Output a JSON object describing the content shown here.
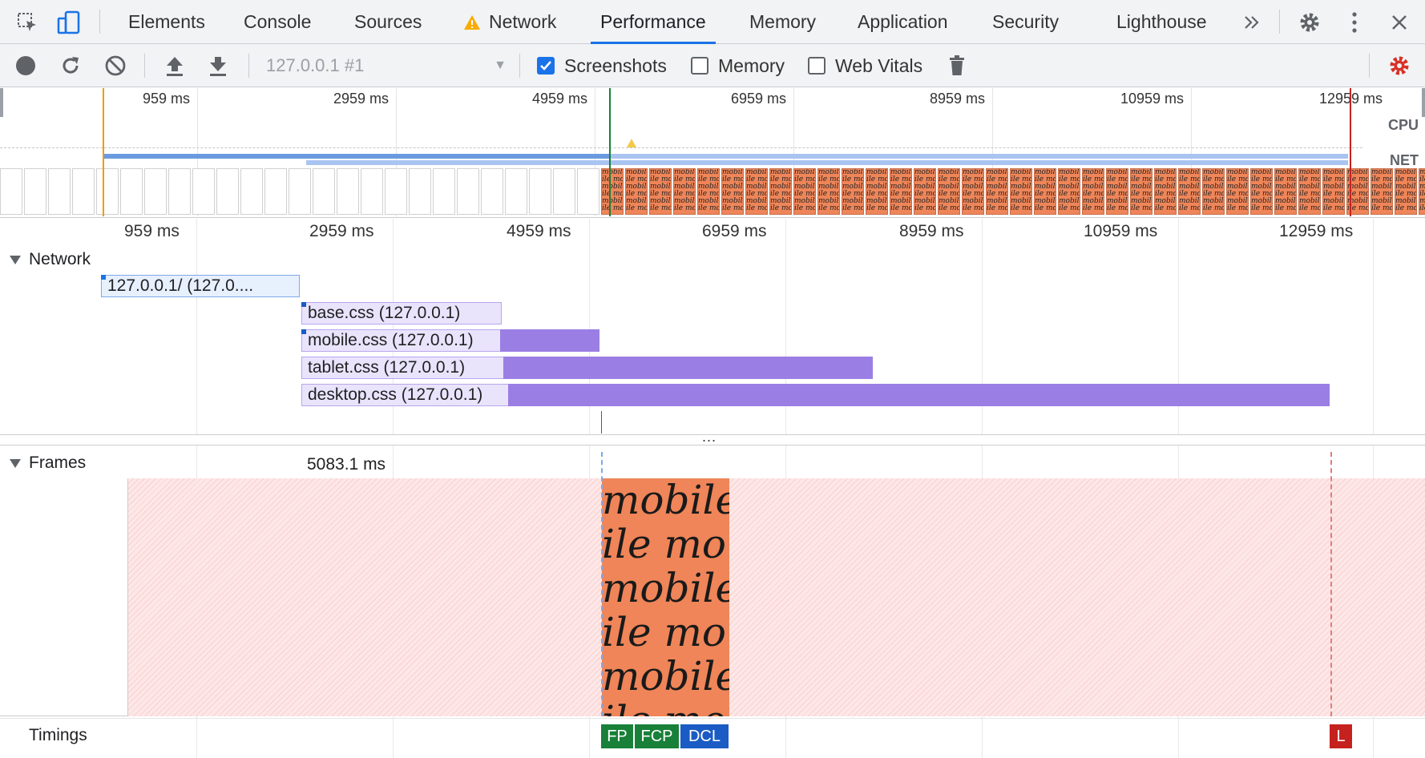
{
  "tabs": [
    {
      "label": "Elements"
    },
    {
      "label": "Console"
    },
    {
      "label": "Sources"
    },
    {
      "label": "Network"
    },
    {
      "label": "Performance"
    },
    {
      "label": "Memory"
    },
    {
      "label": "Application"
    },
    {
      "label": "Security"
    },
    {
      "label": "Lighthouse"
    }
  ],
  "active_tab": "Performance",
  "toolbar": {
    "profile": "127.0.0.1 #1",
    "screenshots_label": "Screenshots",
    "screenshots_checked": true,
    "memory_label": "Memory",
    "memory_checked": false,
    "webvitals_label": "Web Vitals",
    "webvitals_checked": false
  },
  "overview": {
    "ticks": [
      "959 ms",
      "2959 ms",
      "4959 ms",
      "6959 ms",
      "8959 ms",
      "10959 ms",
      "12959 ms"
    ],
    "cpu_label": "CPU",
    "net_label": "NET",
    "screenshot_text": "mobile"
  },
  "ruler": {
    "ticks": [
      "959 ms",
      "2959 ms",
      "4959 ms",
      "6959 ms",
      "8959 ms",
      "10959 ms",
      "12959 ms"
    ]
  },
  "network": {
    "title": "Network",
    "requests": [
      {
        "label": "127.0.0.1/ (127.0...."
      },
      {
        "label": "base.css (127.0.0.1)"
      },
      {
        "label": "mobile.css (127.0.0.1)"
      },
      {
        "label": "tablet.css (127.0.0.1)"
      },
      {
        "label": "desktop.css (127.0.0.1)"
      }
    ]
  },
  "frames": {
    "title": "Frames",
    "duration": "5083.1 ms",
    "thumb_text": "mobile"
  },
  "timings": {
    "title": "Timings",
    "markers": [
      {
        "label": "FP",
        "color": "#188038"
      },
      {
        "label": "FCP",
        "color": "#188038"
      },
      {
        "label": "DCL",
        "color": "#1a5bc4"
      },
      {
        "label": "L",
        "color": "#c5221f"
      }
    ]
  },
  "colors": {
    "accent": "#1a73e8",
    "request_bar": "#9b7ee4",
    "frame_hatch": "#fde7e7"
  }
}
